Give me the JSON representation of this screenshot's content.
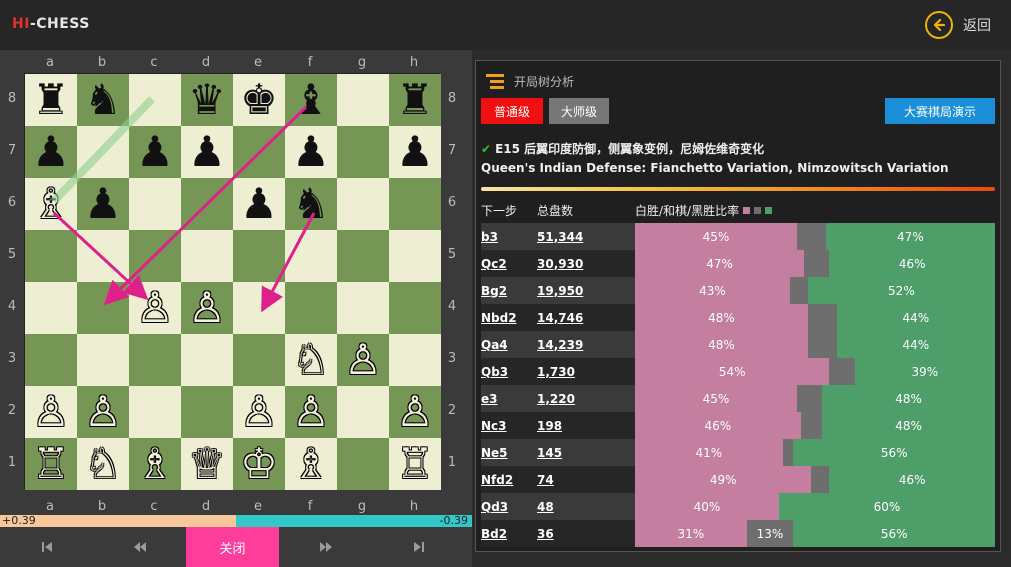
{
  "header": {
    "logo_hi": "HI",
    "logo_chess": "-CHESS",
    "back_label": "返回"
  },
  "board": {
    "files": [
      "a",
      "b",
      "c",
      "d",
      "e",
      "f",
      "g",
      "h"
    ],
    "ranks": [
      "8",
      "7",
      "6",
      "5",
      "4",
      "3",
      "2",
      "1"
    ],
    "position": [
      [
        "bR",
        "bN",
        "",
        "bQ",
        "bK",
        "bB",
        "",
        "bR"
      ],
      [
        "bP",
        "",
        "bP",
        "bP",
        "",
        "bP",
        "",
        "bP"
      ],
      [
        "wB",
        "bP",
        "",
        "",
        "bP",
        "bN",
        "",
        ""
      ],
      [
        "",
        "",
        "",
        "",
        "",
        "",
        "",
        ""
      ],
      [
        "",
        "",
        "wP",
        "wP",
        "",
        "",
        "",
        ""
      ],
      [
        "",
        "",
        "",
        "",
        "",
        "wN",
        "wP",
        ""
      ],
      [
        "wP",
        "wP",
        "",
        "",
        "wP",
        "wP",
        "",
        "wP"
      ],
      [
        "wR",
        "wN",
        "wB",
        "wQ",
        "wK",
        "wB",
        "",
        "wR"
      ]
    ]
  },
  "eval": {
    "white_label": "+0.39",
    "black_label": "-0.39",
    "white_share": 0.5
  },
  "nav": {
    "first": "first-icon",
    "prev": "prev-icon",
    "close_label": "关闭",
    "next": "next-icon",
    "last": "last-icon"
  },
  "panel": {
    "title": "开局树分析",
    "btn_normal": "普通级",
    "btn_master": "大师级",
    "btn_demo": "大赛棋局演示",
    "opening_code": "E15 后翼印度防御，侧翼象变例，尼姆佐维奇变化",
    "opening_en": "Queen's Indian Defense: Fianchetto Variation, Nimzowitsch Variation",
    "col_move": "下一步",
    "col_games": "总盘数",
    "col_ratio": "白胜/和棋/黑胜比率",
    "colors": {
      "white_win": "#c47ea0",
      "draw": "#6e6e6e",
      "black_win": "#4e9e6a"
    },
    "rows": [
      {
        "move": "b3",
        "games": "51,344",
        "w": 45,
        "d": 8,
        "b": 47,
        "w_label": "45%",
        "d_label": "",
        "b_label": "47%"
      },
      {
        "move": "Qc2",
        "games": "30,930",
        "w": 47,
        "d": 7,
        "b": 46,
        "w_label": "47%",
        "d_label": "",
        "b_label": "46%"
      },
      {
        "move": "Bg2",
        "games": "19,950",
        "w": 43,
        "d": 5,
        "b": 52,
        "w_label": "43%",
        "d_label": "",
        "b_label": "52%"
      },
      {
        "move": "Nbd2",
        "games": "14,746",
        "w": 48,
        "d": 8,
        "b": 44,
        "w_label": "48%",
        "d_label": "",
        "b_label": "44%"
      },
      {
        "move": "Qa4",
        "games": "14,239",
        "w": 48,
        "d": 8,
        "b": 44,
        "w_label": "48%",
        "d_label": "",
        "b_label": "44%"
      },
      {
        "move": "Qb3",
        "games": "1,730",
        "w": 54,
        "d": 7,
        "b": 39,
        "w_label": "54%",
        "d_label": "",
        "b_label": "39%"
      },
      {
        "move": "e3",
        "games": "1,220",
        "w": 45,
        "d": 7,
        "b": 48,
        "w_label": "45%",
        "d_label": "",
        "b_label": "48%"
      },
      {
        "move": "Nc3",
        "games": "198",
        "w": 46,
        "d": 6,
        "b": 48,
        "w_label": "46%",
        "d_label": "",
        "b_label": "48%"
      },
      {
        "move": "Ne5",
        "games": "145",
        "w": 41,
        "d": 3,
        "b": 56,
        "w_label": "41%",
        "d_label": "",
        "b_label": "56%"
      },
      {
        "move": "Nfd2",
        "games": "74",
        "w": 49,
        "d": 5,
        "b": 46,
        "w_label": "49%",
        "d_label": "",
        "b_label": "46%"
      },
      {
        "move": "Qd3",
        "games": "48",
        "w": 40,
        "d": 0,
        "b": 60,
        "w_label": "40%",
        "d_label": "",
        "b_label": "60%"
      },
      {
        "move": "Bd2",
        "games": "36",
        "w": 31,
        "d": 13,
        "b": 56,
        "w_label": "31%",
        "d_label": "13%",
        "b_label": "56%"
      }
    ]
  }
}
